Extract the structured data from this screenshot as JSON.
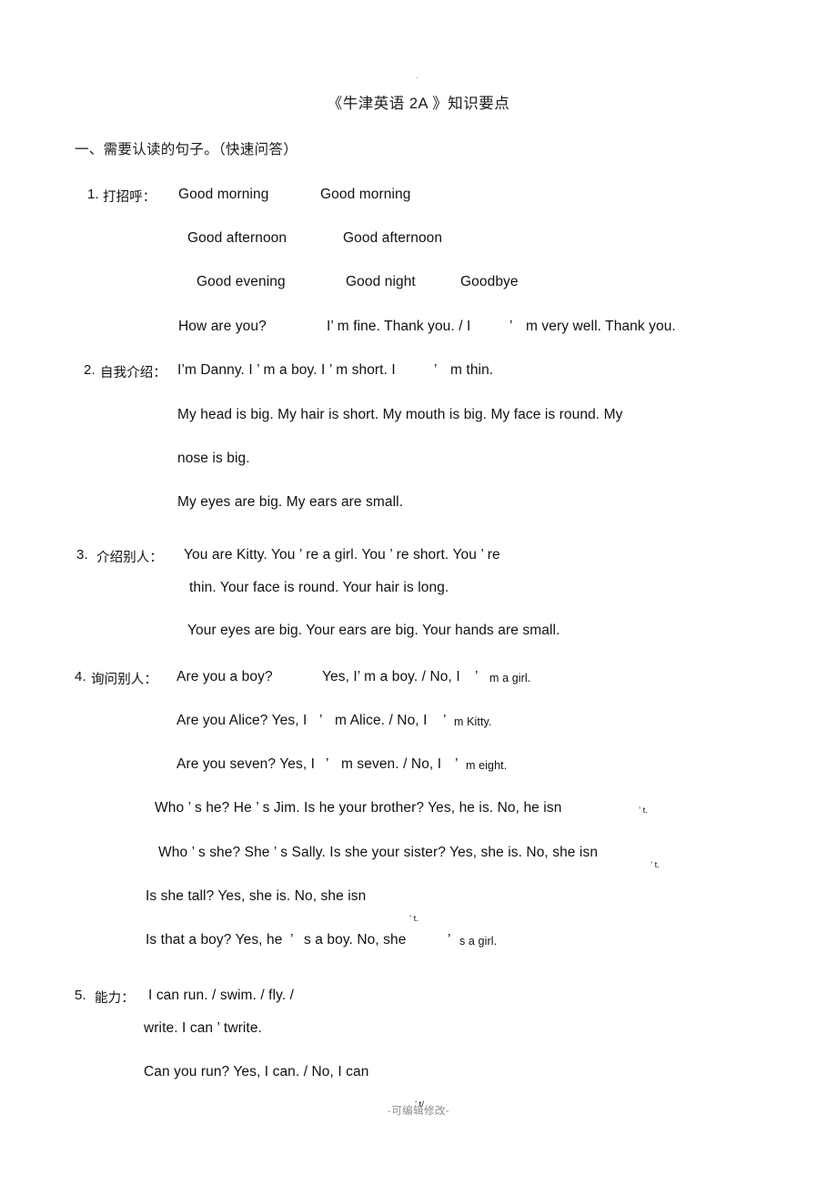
{
  "page": {
    "top_mark": ".",
    "title": "《牛津英语 2A 》知识要点",
    "footer": "-可编辑修改-"
  },
  "section_one": {
    "heading": "一、需要认读的句子。（快速问答）"
  },
  "items": {
    "item1": {
      "number": "1.",
      "label": "打招呼：",
      "l1a": "Good morning",
      "l1b": "Good morning",
      "l2a": "Good afternoon",
      "l2b": "Good afternoon",
      "l3a": "Good evening",
      "l3b": "Good night",
      "l3c": "Goodbye",
      "l4a": "How are you?",
      "l4b": "I’ m fine. Thank you. / I",
      "l4c": "’",
      "l4d": "m very well. Thank you."
    },
    "item2": {
      "number": "2.",
      "label": "自我介绍：",
      "l1": "I’m Danny. I ’ m a boy. I ’ m short. I",
      "l1b": "’",
      "l1c": "m thin.",
      "l2": "My head is big. My hair is short. My mouth is big. My face is round. My",
      "l3": "nose is big.",
      "l4": "My eyes are big. My ears are small."
    },
    "item3": {
      "number": "3.",
      "label": "介绍别人：",
      "l1": "You are Kitty. You ’ re a girl. You ’ re short. You ’ re",
      "l2": "thin. Your face is round. Your hair is long.",
      "l3": "Your eyes are big. Your ears are big. Your hands are small."
    },
    "item4": {
      "number": "4.",
      "label": "询问别人：",
      "l1a": "Are you a boy?",
      "l1b": "Yes, I’ m a boy. / No, I",
      "l1c": "’",
      "l1d": "m a girl.",
      "l2a": "Are you Alice? Yes, I",
      "l2b": "’",
      "l2c": "m Alice. / No, I ",
      "l2d": "’",
      "l2e": "m Kitty.",
      "l3a": "Are you seven? Yes, I",
      "l3b": "’",
      "l3c": "m seven. / No, I ",
      "l3d": "’",
      "l3e": "m eight.",
      "l4a": "Who ’ s he? He ’ s Jim. Is he your brother? Yes, he is. No, he isn",
      "l4b": "’ t.",
      "l5a": "Who ’ s she? She ’ s Sally. Is she your sister? Yes, she is. No, she isn",
      "l5b": "’ t.",
      "l6a": "Is she tall? Yes, she is. No, she isn",
      "l6b": "’ t.",
      "l7a": "Is that a boy? Yes, he",
      "l7b": "’",
      "l7c": "s a boy. No, she ",
      "l7d": "’",
      "l7e": "s a girl."
    },
    "item5": {
      "number": "5.",
      "label": "能力：",
      "l1": "I can run. / swim. / fly. /",
      "l2": "write. I can ’ twrite.",
      "l3a": "Can you run? Yes, I can. / No, I can",
      "l3b": "’ t/"
    }
  }
}
